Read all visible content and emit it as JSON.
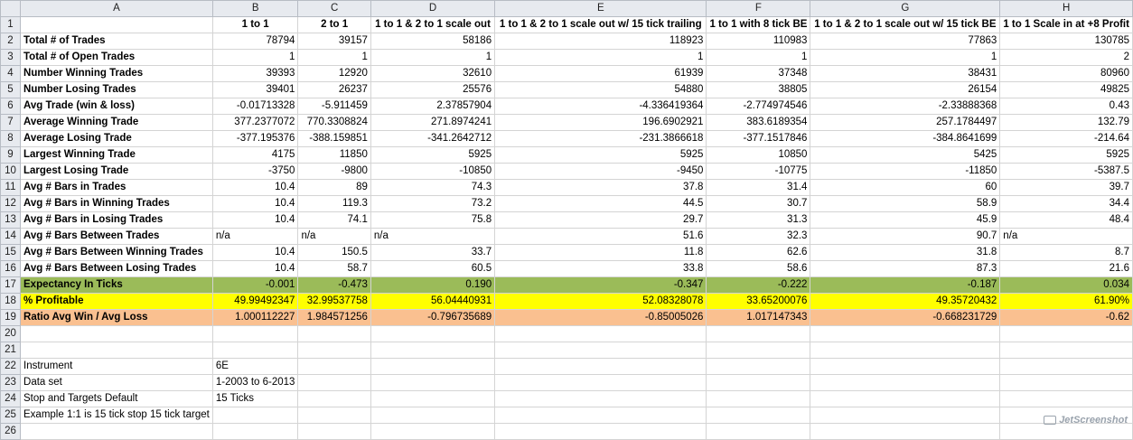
{
  "columns": [
    "A",
    "B",
    "C",
    "D",
    "E",
    "F",
    "G",
    "H"
  ],
  "header": {
    "row": "1",
    "cells": [
      "",
      "1 to 1",
      "2 to 1",
      "1 to 1 & 2 to 1 scale out",
      "1 to 1 & 2 to 1 scale out w/ 15 tick trailing",
      "1 to 1 with 8 tick BE",
      "1 to 1 & 2 to 1 scale out w/ 15 tick BE",
      "1 to 1 Scale in at +8 Profit"
    ]
  },
  "rows": [
    {
      "n": "2",
      "cells": [
        "Total # of Trades",
        "78794",
        "39157",
        "58186",
        "118923",
        "110983",
        "77863",
        "130785"
      ]
    },
    {
      "n": "3",
      "cells": [
        "Total # of Open Trades",
        "1",
        "1",
        "1",
        "1",
        "1",
        "1",
        "2"
      ]
    },
    {
      "n": "4",
      "cells": [
        "Number Winning Trades",
        "39393",
        "12920",
        "32610",
        "61939",
        "37348",
        "38431",
        "80960"
      ]
    },
    {
      "n": "5",
      "cells": [
        "Number Losing Trades",
        "39401",
        "26237",
        "25576",
        "54880",
        "38805",
        "26154",
        "49825"
      ]
    },
    {
      "n": "6",
      "cells": [
        "Avg Trade (win & loss)",
        "-0.01713328",
        "-5.911459",
        "2.37857904",
        "-4.336419364",
        "-2.774974546",
        "-2.33888368",
        "0.43"
      ]
    },
    {
      "n": "7",
      "cells": [
        "Average Winning Trade",
        "377.2377072",
        "770.3308824",
        "271.8974241",
        "196.6902921",
        "383.6189354",
        "257.1784497",
        "132.79"
      ]
    },
    {
      "n": "8",
      "cells": [
        "Average Losing Trade",
        "-377.195376",
        "-388.159851",
        "-341.2642712",
        "-231.3866618",
        "-377.1517846",
        "-384.8641699",
        "-214.64"
      ]
    },
    {
      "n": "9",
      "cells": [
        "Largest Winning Trade",
        "4175",
        "11850",
        "5925",
        "5925",
        "10850",
        "5425",
        "5925"
      ]
    },
    {
      "n": "10",
      "cells": [
        "Largest Losing Trade",
        "-3750",
        "-9800",
        "-10850",
        "-9450",
        "-10775",
        "-11850",
        "-5387.5"
      ]
    },
    {
      "n": "11",
      "cells": [
        "Avg # Bars in Trades",
        "10.4",
        "89",
        "74.3",
        "37.8",
        "31.4",
        "60",
        "39.7"
      ]
    },
    {
      "n": "12",
      "cells": [
        "Avg # Bars in Winning Trades",
        "10.4",
        "119.3",
        "73.2",
        "44.5",
        "30.7",
        "58.9",
        "34.4"
      ]
    },
    {
      "n": "13",
      "cells": [
        "Avg # Bars in Losing Trades",
        "10.4",
        "74.1",
        "75.8",
        "29.7",
        "31.3",
        "45.9",
        "48.4"
      ]
    },
    {
      "n": "14",
      "cells": [
        "Avg # Bars Between Trades",
        "n/a",
        "n/a",
        "n/a",
        "51.6",
        "32.3",
        "90.7",
        "n/a"
      ]
    },
    {
      "n": "15",
      "cells": [
        "Avg # Bars Between Winning Trades",
        "10.4",
        "150.5",
        "33.7",
        "11.8",
        "62.6",
        "31.8",
        "8.7"
      ]
    },
    {
      "n": "16",
      "cells": [
        "Avg # Bars Between Losing Trades",
        "10.4",
        "58.7",
        "60.5",
        "33.8",
        "58.6",
        "87.3",
        "21.6"
      ]
    },
    {
      "n": "17",
      "cells": [
        "Expectancy In Ticks",
        "-0.001",
        "-0.473",
        "0.190",
        "-0.347",
        "-0.222",
        "-0.187",
        "0.034"
      ]
    },
    {
      "n": "18",
      "cells": [
        "% Profitable",
        "49.99492347",
        "32.99537758",
        "56.04440931",
        "52.08328078",
        "33.65200076",
        "49.35720432",
        "61.90%"
      ]
    },
    {
      "n": "19",
      "cells": [
        "Ratio Avg Win / Avg Loss",
        "1.000112227",
        "1.984571256",
        "-0.796735689",
        "-0.85005026",
        "1.017147343",
        "-0.668231729",
        "-0.62"
      ]
    },
    {
      "n": "20",
      "cells": [
        "",
        "",
        "",
        "",
        "",
        "",
        "",
        ""
      ]
    },
    {
      "n": "21",
      "cells": [
        "",
        "",
        "",
        "",
        "",
        "",
        "",
        ""
      ]
    },
    {
      "n": "22",
      "cells": [
        "Instrument",
        "6E",
        "",
        "",
        "",
        "",
        "",
        ""
      ]
    },
    {
      "n": "23",
      "cells": [
        "Data set",
        "1-2003 to 6-2013",
        "",
        "",
        "",
        "",
        "",
        ""
      ]
    },
    {
      "n": "24",
      "cells": [
        "Stop and Targets Default",
        "15 Ticks",
        "",
        "",
        "",
        "",
        "",
        ""
      ]
    },
    {
      "n": "25",
      "cells": [
        "Example 1:1 is 15 tick stop 15 tick target",
        "",
        "",
        "",
        "",
        "",
        "",
        ""
      ]
    },
    {
      "n": "26",
      "cells": [
        "",
        "",
        "",
        "",
        "",
        "",
        "",
        ""
      ]
    }
  ],
  "watermark": "JetScreenshot",
  "colors": {
    "expectancy": "#9bbb59",
    "profitable": "#ffff00",
    "ratio": "#fac090",
    "header_bg": "#e7eaef"
  }
}
